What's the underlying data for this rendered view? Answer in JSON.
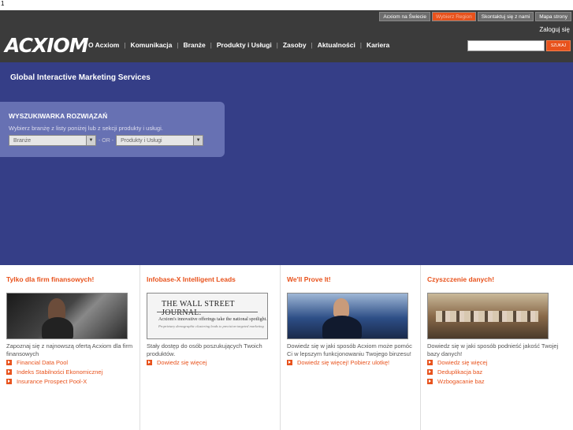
{
  "stray_char": "1",
  "util_nav": [
    {
      "label": "Acxiom na Świecie",
      "active": false
    },
    {
      "label": "Wybierz Region",
      "active": true
    },
    {
      "label": "Skontaktuj się z nami",
      "active": false
    },
    {
      "label": "Mapa strony",
      "active": false
    }
  ],
  "login_label": "Zaloguj się",
  "logo_text": "ACXIOM",
  "main_nav": [
    "O Acxiom",
    "Komunikacja",
    "Branże",
    "Produkty i Usługi",
    "Zasoby",
    "Aktualności",
    "Kariera"
  ],
  "search": {
    "value": "",
    "button_label": "SZUKAJ"
  },
  "hero": {
    "title": "Global Interactive Marketing Services",
    "finder": {
      "title": "WYSZUKIWARKA ROZWIĄZAŃ",
      "description": "Wybierz branżę z listy poniżej lub z sekcji produkty i usługi.",
      "select1": "Branże",
      "or_label": "- OR -",
      "select2": "Produkty i Usługi"
    }
  },
  "columns": [
    {
      "title": "Tylko dla firm finansowych!",
      "text": "Zapoznaj się z najnowszą ofertą Acxiom dla firm finansowych",
      "links": [
        "Financial Data Pool",
        "Indeks Stabilności Ekonomicznej",
        "Insurance Prospect Pool-X"
      ]
    },
    {
      "title": "Infobase-X Intelligent Leads",
      "text": "Stały dostęp do osób poszukujących Twoich produktów.",
      "links": [
        "Dowiedz się więcej"
      ],
      "thumb": {
        "masthead": "THE WALL STREET JOURNAL.",
        "headline": "Acxiom's innovative offerings take the national spotlight.",
        "subline": "Proprietary demographic clustering leads to precision-targeted marketing"
      }
    },
    {
      "title": "We'll Prove It!",
      "text": "Dowiedz się w jaki sposób Acxiom może pomóc Ci w lepszym funkcjonowaniu Twojego binzesu!",
      "links": [
        "Dowiedz się więcej! Pobierz ulotkę!"
      ]
    },
    {
      "title": "Czyszczenie danych!",
      "text": "Dowiedz się w jaki sposób podnieść jakość Twojej bazy danych!",
      "links": [
        "Dowiedz się więcej",
        "Deduplikacja baz",
        "Wzbogacanie baz"
      ]
    }
  ],
  "colors": {
    "accent": "#e8521c",
    "header_bg": "#3b3b3b",
    "hero_bg": "#353e87",
    "finder_bg": "#6771b3"
  },
  "icons": [
    "arrow-bullet-icon",
    "dropdown-arrow-icon"
  ]
}
